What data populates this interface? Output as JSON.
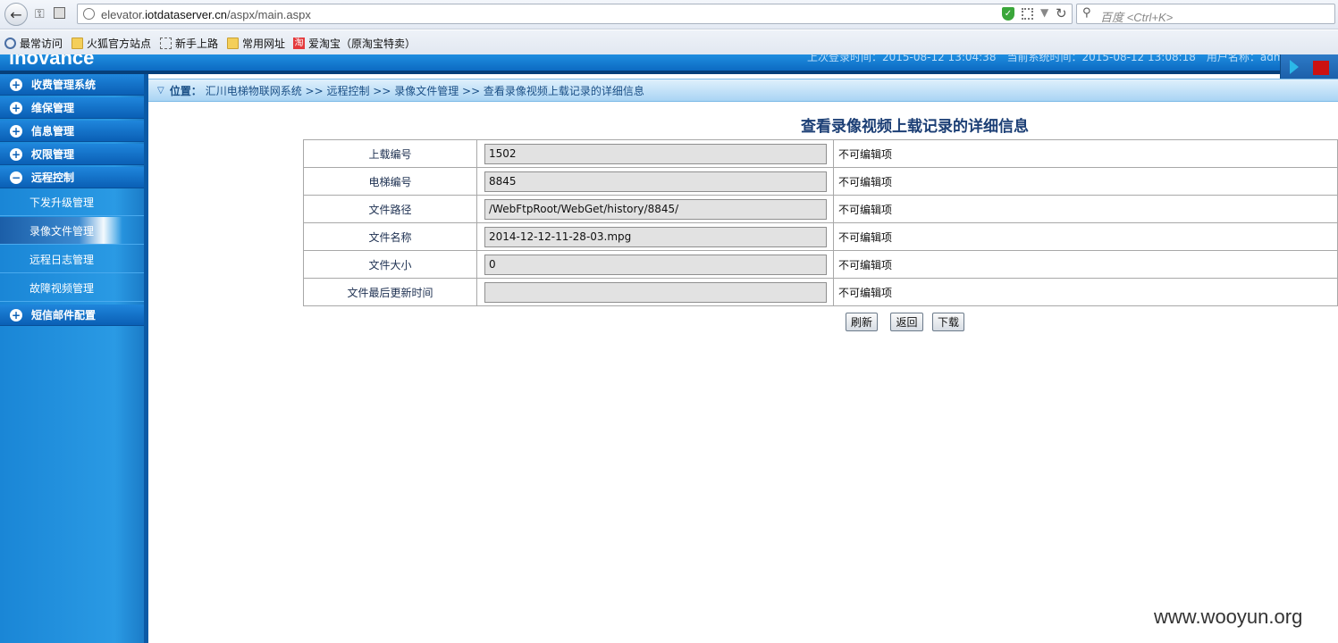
{
  "browser": {
    "url_domain_prefix": "elevator.",
    "url_domain": "iotdataserver.cn",
    "url_path": "/aspx/main.aspx",
    "search_placeholder": "百度 <Ctrl+K>",
    "bookmarks": [
      "最常访问",
      "火狐官方站点",
      "新手上路",
      "常用网址",
      "爱淘宝（原淘宝特卖）"
    ]
  },
  "header": {
    "logo": "inovance",
    "info": "上次登录时间：2015-08-12 13:04:38　当前系统时间：2015-08-12 13:08:18　用户名称：admin(系统管理员)"
  },
  "sidebar": {
    "groups": [
      {
        "label": "收费管理系统",
        "toggle": "+"
      },
      {
        "label": "维保管理",
        "toggle": "+"
      },
      {
        "label": "信息管理",
        "toggle": "+"
      },
      {
        "label": "权限管理",
        "toggle": "+"
      },
      {
        "label": "远程控制",
        "toggle": "−"
      }
    ],
    "sub_items": [
      {
        "label": "下发升级管理"
      },
      {
        "label": "录像文件管理"
      },
      {
        "label": "远程日志管理"
      },
      {
        "label": "故障视频管理"
      }
    ],
    "last_group": {
      "label": "短信邮件配置",
      "toggle": "+"
    }
  },
  "breadcrumb": {
    "label": "位置：",
    "path": "汇川电梯物联网系统 >> 远程控制 >> 录像文件管理 >> 查看录像视频上载记录的详细信息"
  },
  "page_title": "查看录像视频上载记录的详细信息",
  "table": {
    "rows": [
      {
        "label": "上载编号",
        "value": "1502",
        "note": "不可编辑项"
      },
      {
        "label": "电梯编号",
        "value": "8845",
        "note": "不可编辑项"
      },
      {
        "label": "文件路径",
        "value": "/WebFtpRoot/WebGet/history/8845/",
        "note": "不可编辑项"
      },
      {
        "label": "文件名称",
        "value": "2014-12-12-11-28-03.mpg",
        "note": "不可编辑项"
      },
      {
        "label": "文件大小",
        "value": "0",
        "note": "不可编辑项"
      },
      {
        "label": "文件最后更新时间",
        "value": "",
        "note": "不可编辑项"
      }
    ]
  },
  "buttons": {
    "refresh": "刷新",
    "back": "返回",
    "download": "下载"
  },
  "watermark": "www.wooyun.org"
}
